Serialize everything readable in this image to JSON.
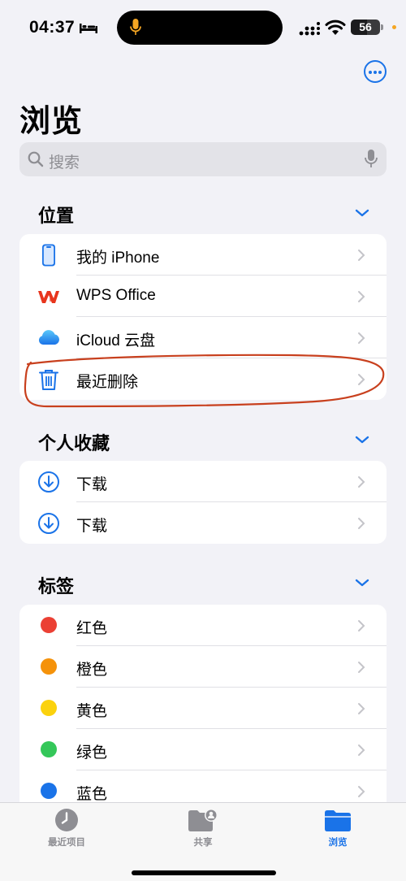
{
  "status_bar": {
    "time": "04:37",
    "battery": "56",
    "battery_level": 0.56
  },
  "header": {
    "title": "浏览",
    "more_icon": "ellipsis-circle-icon"
  },
  "search": {
    "placeholder": "搜索"
  },
  "sections": {
    "locations": {
      "title": "位置",
      "items": [
        {
          "label": "我的 iPhone",
          "icon": "iphone-icon"
        },
        {
          "label": "WPS Office",
          "icon": "wps-office-icon"
        },
        {
          "label": "iCloud 云盘",
          "icon": "icloud-icon"
        },
        {
          "label": "最近删除",
          "icon": "trash-icon"
        }
      ]
    },
    "favorites": {
      "title": "个人收藏",
      "items": [
        {
          "label": "下载",
          "icon": "download-circle-icon"
        },
        {
          "label": "下载",
          "icon": "download-circle-icon"
        }
      ]
    },
    "tags": {
      "title": "标签",
      "items": [
        {
          "label": "红色",
          "color": "#eb4034"
        },
        {
          "label": "橙色",
          "color": "#f5920a"
        },
        {
          "label": "黄色",
          "color": "#fbd20d"
        },
        {
          "label": "绿色",
          "color": "#34c759"
        },
        {
          "label": "蓝色",
          "color": "#1a73e8"
        }
      ]
    }
  },
  "tab_bar": {
    "tabs": [
      {
        "label": "最近项目",
        "icon": "clock-icon",
        "active": false
      },
      {
        "label": "共享",
        "icon": "shared-folder-icon",
        "active": false
      },
      {
        "label": "浏览",
        "icon": "folder-icon",
        "active": true
      }
    ]
  },
  "colors": {
    "accent": "#1a73e8",
    "annotation": "#c8401e"
  }
}
